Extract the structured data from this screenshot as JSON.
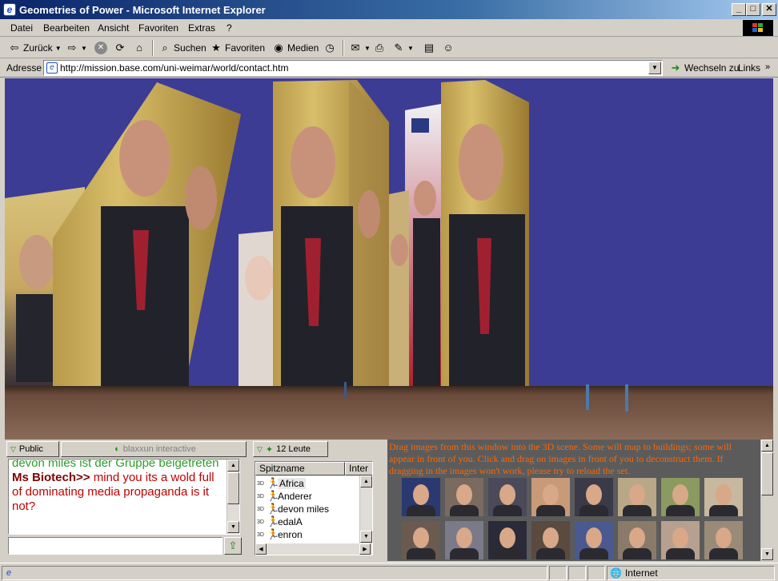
{
  "window": {
    "title": "Geometries of Power - Microsoft Internet Explorer",
    "controls": [
      "_",
      "□",
      "✕"
    ]
  },
  "menu": [
    "Datei",
    "Bearbeiten",
    "Ansicht",
    "Favoriten",
    "Extras",
    "?"
  ],
  "toolbar": {
    "back": "Zurück",
    "search": "Suchen",
    "favorites": "Favoriten",
    "media": "Medien"
  },
  "address": {
    "label": "Adresse",
    "url": "http://mission.base.com/uni-weimar/world/contact.htm",
    "go": "Wechseln zu",
    "links": "Links"
  },
  "chat": {
    "tab_public": "Public",
    "tab_brand": "blaxxun interactive",
    "messages": [
      {
        "text": "devon miles ist der Gruppe beigetreten",
        "color": "#2e9a2e"
      },
      {
        "speaker": "Ms Biotech>>",
        "text": " mind you its a wold full of dominating media propaganda is it not?",
        "color": "#c00000"
      }
    ]
  },
  "users": {
    "tab_label": "12 Leute",
    "columns": [
      "Spitzname",
      "Inter"
    ],
    "tag": "3D",
    "list": [
      "Africa",
      "Anderer",
      "devon miles",
      "edalA",
      "enron"
    ]
  },
  "images_panel": {
    "instructions": "Drag images from this window into the 3D scene. Some will map to buildings; some will appear in front of you. Click and drag on images in front of you to deconstruct them. If dragging in the images won't work, please try to reload the set.",
    "thumbnail_count": 16
  },
  "status": {
    "zone": "Internet"
  },
  "colors": {
    "sky": "#3c3c94",
    "ground": "#7a5a48",
    "instructions_text": "#ff6600",
    "chat_join": "#2e9a2e",
    "chat_msg": "#c00000"
  }
}
